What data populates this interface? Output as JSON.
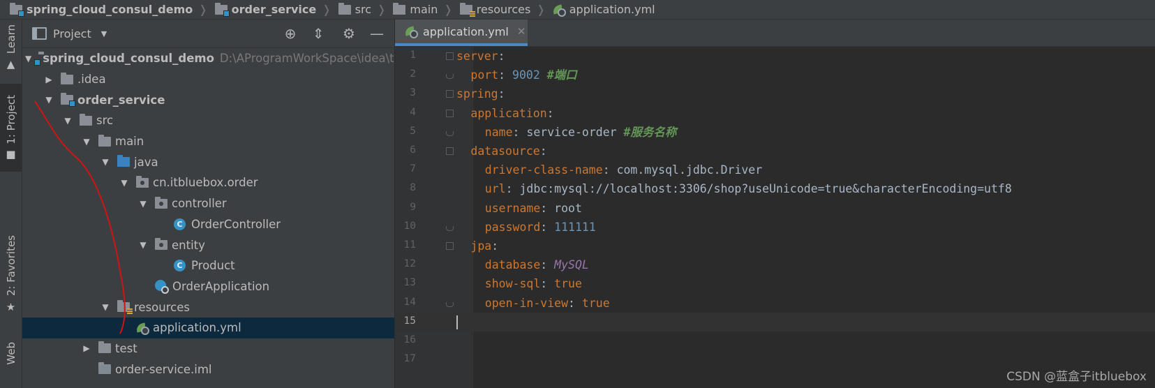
{
  "breadcrumbs": [
    {
      "label": "spring_cloud_consul_demo",
      "icon": "project-folder-icon",
      "bold": true
    },
    {
      "label": "order_service",
      "icon": "module-folder-icon",
      "bold": true
    },
    {
      "label": "src",
      "icon": "folder-icon",
      "bold": false
    },
    {
      "label": "main",
      "icon": "folder-icon",
      "bold": false
    },
    {
      "label": "resources",
      "icon": "resources-folder-icon",
      "bold": false
    },
    {
      "label": "application.yml",
      "icon": "yml-file-icon",
      "bold": false
    }
  ],
  "side_tabs": {
    "learn": "Learn",
    "project": "1: Project",
    "favorites": "2: Favorites",
    "web": "Web"
  },
  "project_panel": {
    "title": "Project",
    "tree": [
      {
        "label": "spring_cloud_consul_demo",
        "path": "D:\\AProgramWorkSpace\\idea\\test",
        "expanded": true,
        "bold": true,
        "icon": "module-folder-icon"
      },
      {
        "label": ".idea",
        "expanded": false,
        "icon": "folder-icon"
      },
      {
        "label": "order_service",
        "expanded": true,
        "bold": true,
        "icon": "module-folder-icon"
      },
      {
        "label": "src",
        "expanded": true,
        "icon": "folder-icon"
      },
      {
        "label": "main",
        "expanded": true,
        "icon": "folder-icon"
      },
      {
        "label": "java",
        "expanded": true,
        "icon": "source-folder-icon"
      },
      {
        "label": "cn.itbluebox.order",
        "expanded": true,
        "icon": "package-icon"
      },
      {
        "label": "controller",
        "expanded": true,
        "icon": "package-icon"
      },
      {
        "label": "OrderController",
        "icon": "class-icon",
        "badge": "C"
      },
      {
        "label": "entity",
        "expanded": true,
        "icon": "package-icon"
      },
      {
        "label": "Product",
        "icon": "class-icon",
        "badge": "C"
      },
      {
        "label": "OrderApplication",
        "icon": "spring-boot-class-icon"
      },
      {
        "label": "resources",
        "expanded": true,
        "icon": "resources-folder-icon"
      },
      {
        "label": "application.yml",
        "icon": "yml-file-icon",
        "selected": true
      },
      {
        "label": "test",
        "expanded": false,
        "icon": "folder-icon"
      },
      {
        "label": "order-service.iml",
        "icon": "iml-file-icon"
      }
    ]
  },
  "editor": {
    "tab_label": "application.yml",
    "current_line": 15,
    "line_numbers": [
      "1",
      "2",
      "3",
      "4",
      "5",
      "6",
      "7",
      "8",
      "9",
      "10",
      "11",
      "12",
      "13",
      "14",
      "15",
      "16",
      "17"
    ],
    "lines": [
      {
        "key": "server",
        "indent": 0
      },
      {
        "key": "port",
        "indent": 1,
        "value": "9002",
        "vtype": "num",
        "comment": "#端口"
      },
      {
        "key": "spring",
        "indent": 0
      },
      {
        "key": "application",
        "indent": 1
      },
      {
        "key": "name",
        "indent": 2,
        "value": "service-order",
        "vtype": "str",
        "comment": "#服务名称"
      },
      {
        "key": "datasource",
        "indent": 1
      },
      {
        "key": "driver-class-name",
        "indent": 2,
        "value": "com.mysql.jdbc.Driver",
        "vtype": "str"
      },
      {
        "key": "url",
        "indent": 2,
        "value": "jdbc:mysql://localhost:3306/shop?useUnicode=true&characterEncoding=utf8",
        "vtype": "str"
      },
      {
        "key": "username",
        "indent": 2,
        "value": "root",
        "vtype": "str"
      },
      {
        "key": "password",
        "indent": 2,
        "value": "111111",
        "vtype": "num"
      },
      {
        "key": "jpa",
        "indent": 1
      },
      {
        "key": "database",
        "indent": 2,
        "value": "MySQL",
        "vtype": "enum"
      },
      {
        "key": "show-sql",
        "indent": 2,
        "value": "true",
        "vtype": "kw"
      },
      {
        "key": "open-in-view",
        "indent": 2,
        "value": "true",
        "vtype": "kw"
      }
    ]
  },
  "watermark": "CSDN @蓝盒子itbluebox",
  "colors": {
    "key": "#cc7832",
    "number": "#6897bb",
    "comment": "#629755",
    "enum": "#9876aa",
    "selection": "#0d293e",
    "tab_underline": "#4a88c7"
  }
}
